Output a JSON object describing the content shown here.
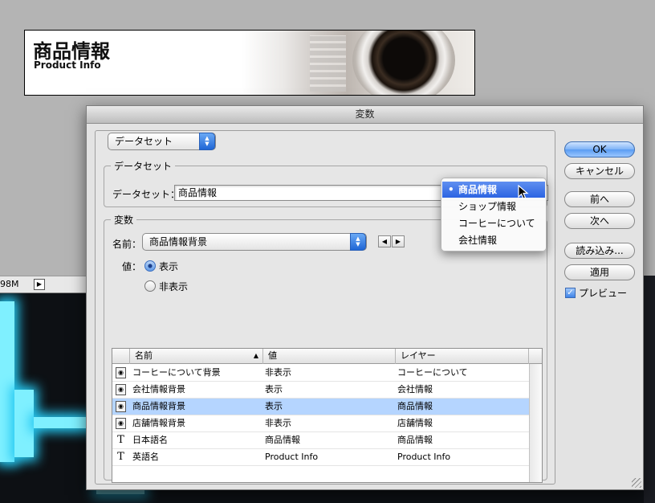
{
  "banner": {
    "title": "商品情報",
    "subtitle": "Product Info"
  },
  "status": {
    "doc_size": "98M",
    "arrow": "▶"
  },
  "dialog": {
    "title": "変数",
    "mode_popup": "データセット",
    "dataset_group": {
      "label": "データセット",
      "field_label": "データセット：",
      "field_value": "商品情報"
    },
    "variable_group": {
      "label": "変数",
      "name_label": "名前：",
      "name_value": "商品情報背景",
      "value_label": "値：",
      "radio_show": "表示",
      "radio_hide": "非表示"
    },
    "table": {
      "headers": {
        "name": "名前",
        "sort_indicator": "▲",
        "value": "値",
        "layer": "レイヤー"
      },
      "rows": [
        {
          "type": "visibility",
          "name": "コーヒーについて背景",
          "value": "非表示",
          "layer": "コーヒーについて"
        },
        {
          "type": "visibility",
          "name": "会社情報背景",
          "value": "表示",
          "layer": "会社情報"
        },
        {
          "type": "visibility",
          "name": "商品情報背景",
          "value": "表示",
          "layer": "商品情報",
          "selected": true
        },
        {
          "type": "visibility",
          "name": "店舗情報背景",
          "value": "非表示",
          "layer": "店舗情報"
        },
        {
          "type": "text",
          "name": "日本語名",
          "value": "商品情報",
          "layer": "商品情報"
        },
        {
          "type": "text",
          "name": "英語名",
          "value": "Product Info",
          "layer": "Product Info"
        }
      ]
    },
    "buttons": {
      "ok": "OK",
      "cancel": "キャンセル",
      "prev": "前へ",
      "next": "次へ",
      "load": "読み込み...",
      "apply": "適用"
    },
    "preview_label": "プレビュー",
    "preview_checked": true
  },
  "dataset_menu": {
    "items": [
      "商品情報",
      "ショップ情報",
      "コーヒーについて",
      "会社情報"
    ],
    "selected_index": 0,
    "bullet": "•"
  },
  "icons": {
    "visibility_row": "eye-icon",
    "text_row": "T"
  },
  "colors": {
    "selection": "#b5d5ff",
    "menu_highlight": "#2c64e2",
    "canvas_glow": "#7ff0ff"
  }
}
